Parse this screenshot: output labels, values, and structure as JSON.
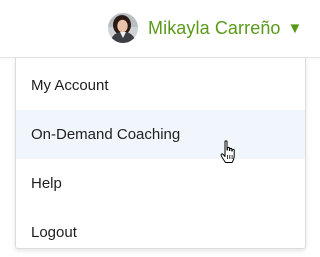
{
  "header": {
    "user_name": "Mikayla Carreño",
    "avatar_icon": "user-avatar-photo",
    "caret_icon": "caret-down-icon",
    "caret_glyph": "▼",
    "accent_color": "#5a9a1a"
  },
  "menu": {
    "items": [
      {
        "label": "My Account"
      },
      {
        "label": "On-Demand Coaching",
        "hovered": true
      },
      {
        "label": "Help"
      },
      {
        "label": "Logout"
      }
    ],
    "hover_background": "#f1f6fc"
  },
  "cursor": {
    "icon": "hand-pointer-cursor-icon"
  }
}
